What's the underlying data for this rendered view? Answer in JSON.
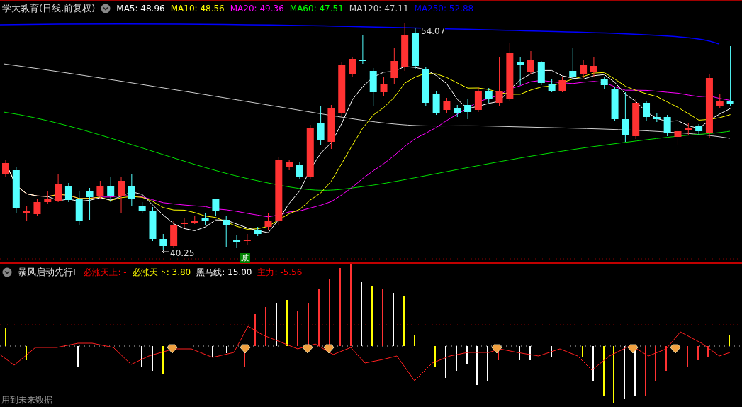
{
  "main_chart": {
    "title": "学大教育(日线,前复权)",
    "legend": [
      {
        "label": "MA5: 48.96",
        "color": "#ffffff"
      },
      {
        "label": "MA10: 48.56",
        "color": "#ffff00"
      },
      {
        "label": "MA20: 49.36",
        "color": "#ff00ff"
      },
      {
        "label": "MA60: 47.51",
        "color": "#00ff00"
      },
      {
        "label": "MA120: 47.11",
        "color": "#d0d0d0"
      },
      {
        "label": "MA250: 52.88",
        "color": "#0000ff"
      }
    ],
    "high_marker": "54.07",
    "low_marker": "40.25",
    "signal_tag": "减"
  },
  "indicator": {
    "title": "暴风启动先行F",
    "legend": [
      {
        "label": "必涨天上: -",
        "color": "#ff0000"
      },
      {
        "label": "必涨天下: 3.80",
        "color": "#ffff00"
      },
      {
        "label": "黑马线: 15.00",
        "color": "#ffffff"
      },
      {
        "label": "主力: -5.56",
        "color": "#ff0000"
      }
    ]
  },
  "status_bar": "用到未来数据"
}
